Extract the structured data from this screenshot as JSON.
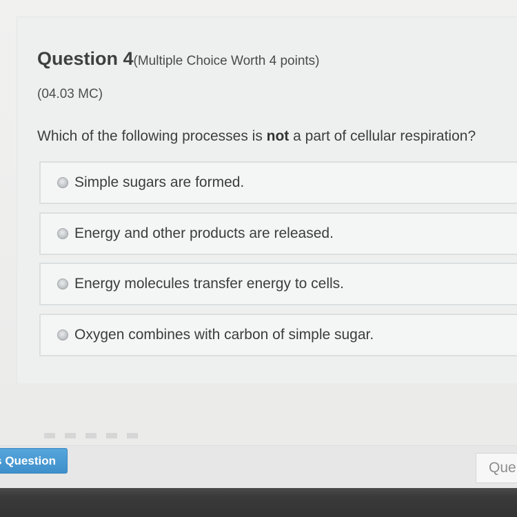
{
  "question": {
    "title": "Question 4",
    "meta": "(Multiple Choice Worth 4 points)",
    "code": "(04.03 MC)",
    "stem_before": "Which of the following processes is ",
    "stem_bold": "not",
    "stem_after": " a part of cellular respiration?"
  },
  "options": [
    {
      "label": "Simple sugars are formed."
    },
    {
      "label": "Energy and other products are released."
    },
    {
      "label": "Energy molecules transfer energy to cells."
    },
    {
      "label": "Oxygen combines with carbon of simple sugar."
    }
  ],
  "navigation": {
    "previous_label": "s Question",
    "next_label": "Que"
  },
  "colors": {
    "button_blue": "#4a9ad4",
    "panel_bg": "#eef0f0"
  }
}
